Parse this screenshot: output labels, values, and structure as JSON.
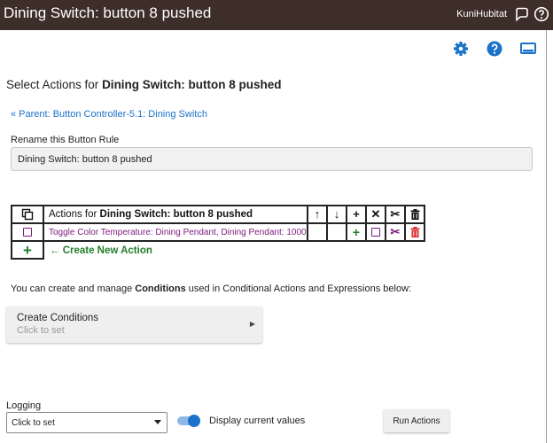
{
  "topbar": {
    "title": "Dining Switch: button 8 pushed",
    "hub_name": "KuniHubitat",
    "icons": [
      "chat-icon",
      "help-circle-icon"
    ]
  },
  "toolbar": {
    "icons": [
      "gear-icon",
      "help-icon",
      "monitor-icon"
    ],
    "accent": "#1a73c9"
  },
  "page": {
    "heading_prefix": "Select Actions for ",
    "heading_bold": "Dining Switch: button 8 pushed",
    "parent_link": "« Parent: Button Controller-5.1: Dining Switch"
  },
  "rename": {
    "label": "Rename this Button Rule",
    "value": "Dining Switch: button 8 pushed"
  },
  "actions_table": {
    "header_prefix": "Actions for ",
    "header_bold": "Dining Switch: button 8 pushed",
    "header_symbols": [
      "↑",
      "↓",
      "+",
      "✕",
      "✂",
      "🗑"
    ],
    "rows": [
      {
        "text": "Toggle Color Temperature: Dining Pendant, Dining Pendant: 1000"
      }
    ],
    "add_symbol": "+",
    "create_new": "← Create New Action"
  },
  "conditions": {
    "text_prefix": "You can create and manage ",
    "text_bold": "Conditions",
    "text_suffix": " used in Conditional Actions and Expressions below:",
    "button_title": "Create Conditions",
    "button_subtitle": "Click to set",
    "arrow": "▶"
  },
  "logging": {
    "label": "Logging",
    "select_value": "Click to set",
    "toggle_label": "Display current values",
    "toggle_on": true,
    "run_button": "Run Actions"
  },
  "colors": {
    "topbar_bg": "#3e2e2a",
    "link_blue": "#1a73c9",
    "action_purple": "#7a1a7e",
    "add_green": "#1f7d2a",
    "delete_red": "#d9302f"
  }
}
